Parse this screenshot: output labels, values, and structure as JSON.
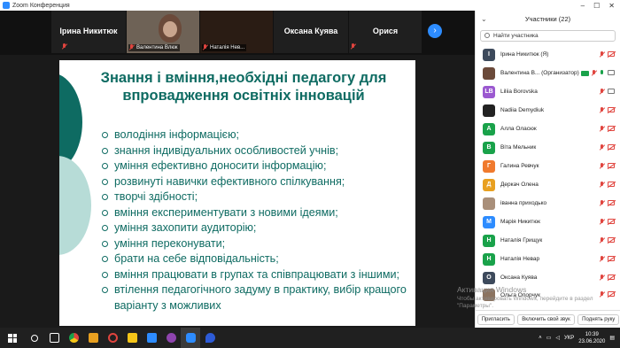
{
  "window": {
    "title": "Zoom Конференция"
  },
  "video_strip": {
    "tiles": [
      {
        "name": "Ірина Никитюк"
      },
      {
        "name": "Валентина Влюк"
      },
      {
        "name": "Наталія Нев..."
      },
      {
        "name": "Оксана Куява"
      },
      {
        "name": "Орися"
      }
    ]
  },
  "slide": {
    "title": "Знання і вміння,необхідні педагогу для впровадження освітніх інновацій",
    "bullets": [
      "володіння інформацією;",
      "знання індивідуальних особливостей учнів;",
      "уміння ефективно доносити інформацію;",
      "розвинуті навички ефективного спілкування;",
      "творчі здібності;",
      "вміння експериментувати з новими ідеями;",
      "уміння захопити аудиторію;",
      "уміння переконувати;",
      "брати на себе відповідальність;",
      "вміння працювати в групах та співпрацювати з іншими;",
      "втілення педагогічного задуму в практику, вибір кращого варіанту з можливих"
    ]
  },
  "participants_panel": {
    "title": "Участники (22)",
    "search_placeholder": "Найти участника",
    "participants": [
      {
        "initial": "І",
        "name": "Ірина Никитюк (Я)",
        "color": "#3d4a5c"
      },
      {
        "initial": "",
        "name": "Валентина В... (Организатор)",
        "color": "#6b4a3a"
      },
      {
        "initial": "LB",
        "name": "Liliia Borovska",
        "color": "#9b59d0"
      },
      {
        "initial": "",
        "name": "Nadiia Demydiuk",
        "color": "#222222"
      },
      {
        "initial": "А",
        "name": "Алла Оласюк",
        "color": "#19a24a"
      },
      {
        "initial": "В",
        "name": "Віта Мельник",
        "color": "#19a24a"
      },
      {
        "initial": "Г",
        "name": "Галина Ревчук",
        "color": "#f07a2e"
      },
      {
        "initial": "Д",
        "name": "Деркач Олена",
        "color": "#e8a020"
      },
      {
        "initial": "",
        "name": "іванна приходько",
        "color": "#a98f7a"
      },
      {
        "initial": "М",
        "name": "Марія Никитюк",
        "color": "#2d8cff"
      },
      {
        "initial": "Н",
        "name": "Наталія Грищук",
        "color": "#19a24a"
      },
      {
        "initial": "Н",
        "name": "Наталія Невар",
        "color": "#19a24a"
      },
      {
        "initial": "О",
        "name": "Оксана Куява",
        "color": "#3d4a5c"
      },
      {
        "initial": "",
        "name": "Ольга Опорчук",
        "color": "#8b7360"
      }
    ],
    "footer": {
      "invite": "Пригласить",
      "unmute_me": "Включить свой звук",
      "raise_hand": "Поднять руку"
    }
  },
  "watermark": {
    "line1": "Активация Windows",
    "line2": "Чтобы активировать Windows, перейдите в раздел \"Параметры\"."
  },
  "taskbar": {
    "time": "10:39",
    "date": "23.06.2020",
    "lang": "УКР"
  }
}
